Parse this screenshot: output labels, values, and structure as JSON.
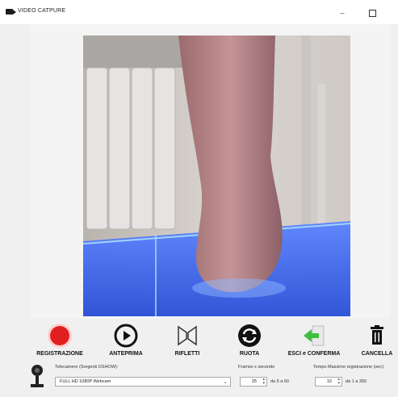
{
  "window": {
    "title": "VIDEO CATPURE",
    "minimize": "–"
  },
  "toolbar": {
    "record": "REGISTRAZIONE",
    "preview": "ANTEPRIMA",
    "mirror": "RIFLETTI",
    "rotate": "RUOTA",
    "exit_confirm": "ESCI e CONFERMA",
    "cancel": "CANCELLA"
  },
  "settings": {
    "camera_label": "Telecamere (Sorgenti DSHOW):",
    "camera_value": "FULL HD 1080P Webcam",
    "fps_label": "Frames x secondo",
    "fps_value": "25",
    "fps_range": "da 5 a 60",
    "maxtime_label": "Tempo Massimo registrazione (sec):",
    "maxtime_value": "10",
    "maxtime_range": "da 1 a 300"
  },
  "colors": {
    "record": "#e02020",
    "exit_arrow": "#3fbf3f",
    "glass": "#3a6bff"
  }
}
